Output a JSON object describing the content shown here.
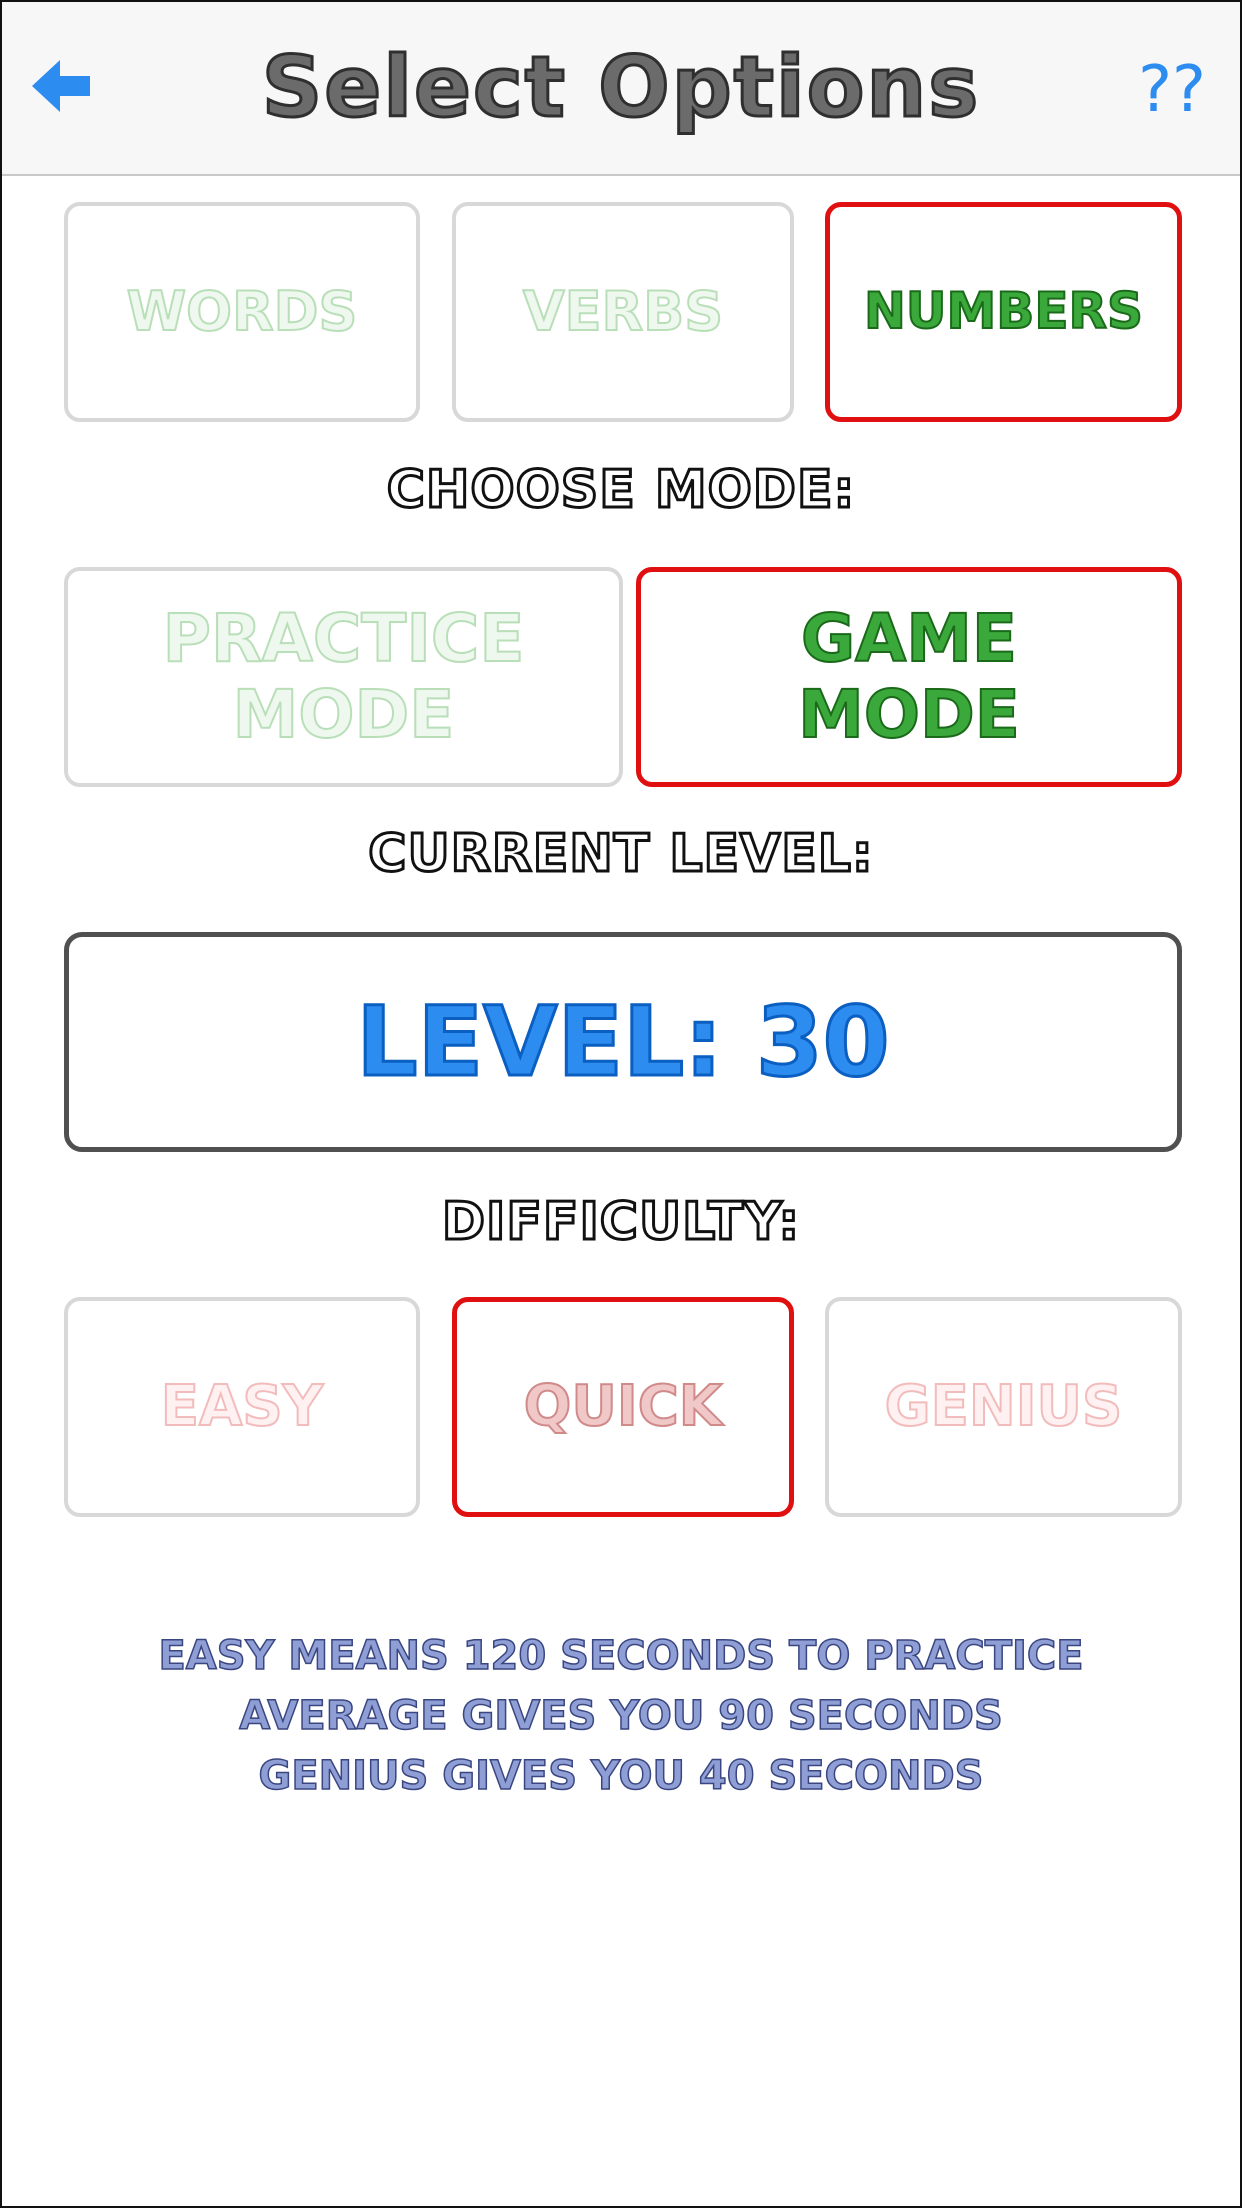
{
  "navbar": {
    "title": "Select Options",
    "help_label": "??",
    "back_icon": "arrow-left-icon",
    "accent_color": "#2d8cf0"
  },
  "category": {
    "options": [
      {
        "label": "Words",
        "selected": false
      },
      {
        "label": "Verbs",
        "selected": false
      },
      {
        "label": "Numbers",
        "selected": true
      }
    ]
  },
  "mode": {
    "heading": "Choose Mode:",
    "options": [
      {
        "line1": "Practice",
        "line2": "Mode",
        "selected": false
      },
      {
        "line1": "Game",
        "line2": "Mode",
        "selected": true
      }
    ]
  },
  "level": {
    "heading": "Current Level:",
    "value": "Level: 30"
  },
  "difficulty": {
    "heading": "Difficulty:",
    "options": [
      {
        "label": "Easy",
        "selected": false
      },
      {
        "label": "Quick",
        "selected": true
      },
      {
        "label": "Genius",
        "selected": false
      }
    ]
  },
  "info": {
    "lines": [
      "Easy means 120 seconds to practice",
      "Average gives you 90 seconds",
      "Genius gives you 40 seconds"
    ]
  },
  "colors": {
    "selected_border": "#e01010",
    "unselected_border": "#d8d8d8",
    "level_border": "#505050"
  }
}
